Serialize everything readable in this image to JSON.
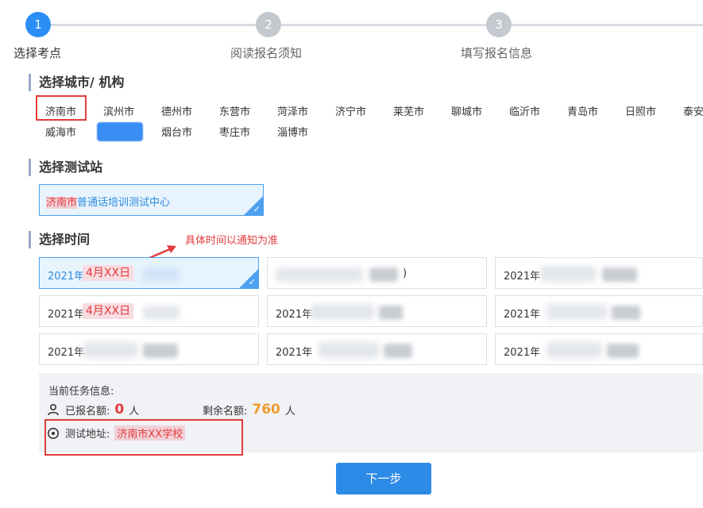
{
  "steps": [
    {
      "number": "1",
      "label": "选择考点"
    },
    {
      "number": "2",
      "label": "阅读报名须知"
    },
    {
      "number": "3",
      "label": "填写报名信息"
    }
  ],
  "sections": {
    "city_title": "选择城市/ 机构",
    "station_title": "选择测试站",
    "time_title": "选择时间"
  },
  "cities_row1": [
    "济南市",
    "滨州市",
    "德州市",
    "东营市",
    "菏泽市",
    "济宁市",
    "莱芜市",
    "聊城市",
    "临沂市",
    "青岛市",
    "日照市",
    "泰安"
  ],
  "cities_row2": [
    "威海市",
    "",
    "烟台市",
    "枣庄市",
    "淄博市"
  ],
  "station": {
    "city": "济南市",
    "name": "普通话培训测试中心"
  },
  "annotation": "具体时间以通知为准",
  "times": [
    {
      "prefix": "2021年",
      "overlay": "4月XX日",
      "selected": true
    },
    {
      "prefix": "",
      "suffix": ")",
      "selected": false
    },
    {
      "prefix": "2021年",
      "selected": false
    },
    {
      "prefix": "2021年",
      "overlay": "4月XX日",
      "selected": false
    },
    {
      "prefix": "2021年",
      "selected": false
    },
    {
      "prefix": "2021年",
      "selected": false
    },
    {
      "prefix": "2021年",
      "selected": false
    },
    {
      "prefix": "2021年",
      "selected": false
    },
    {
      "prefix": "2021年",
      "selected": false
    }
  ],
  "info": {
    "title": "当前任务信息:",
    "registered_label": "已报名额:",
    "registered_value": "0",
    "registered_unit": "人",
    "remaining_label": "剩余名额:",
    "remaining_value": "760",
    "remaining_unit": "人",
    "address_label": "测试地址:",
    "address_value": "济南市XX学校"
  },
  "next_button": "下一步",
  "icons": {
    "user": "user-icon",
    "location": "location-pin-icon",
    "check": "checkmark-icon"
  },
  "colors": {
    "accent": "#2a8ef5",
    "highlight_red": "#e23c3c",
    "remaining_orange": "#f39b2e"
  }
}
